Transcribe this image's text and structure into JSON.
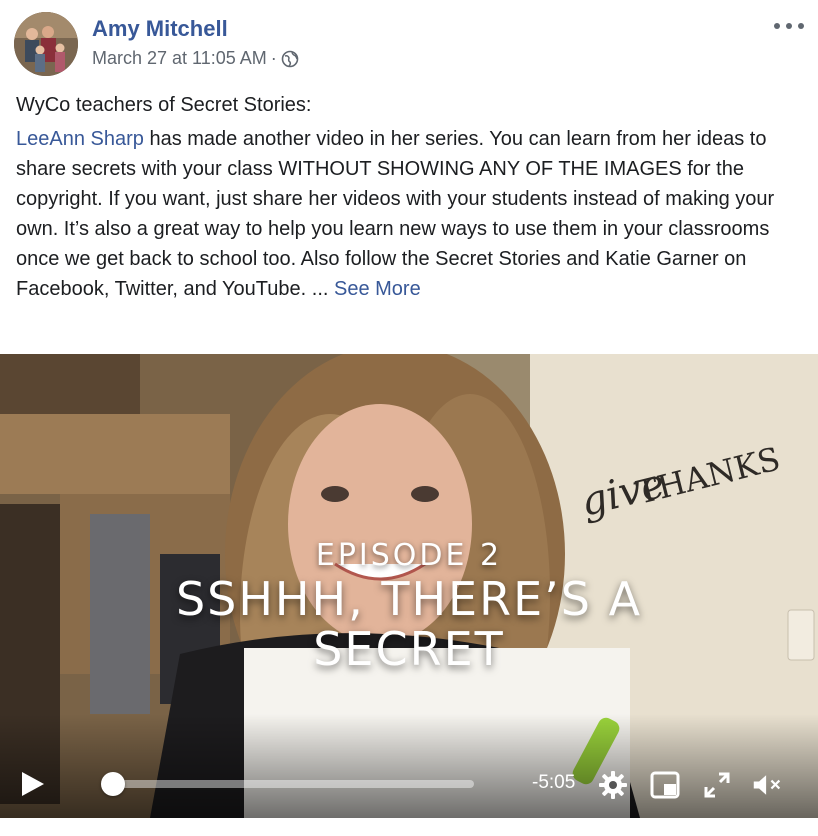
{
  "post": {
    "author": "Amy Mitchell",
    "timestamp": "March 27 at 11:05 AM",
    "separator": "·",
    "privacy_icon": "globe-icon",
    "more_icon": "more-options-icon"
  },
  "text": {
    "intro": "WyCo teachers of Secret Stories:",
    "mention": "LeeAnn Sharp",
    "body": " has made another video in her series. You can learn from her ideas to share secrets with your class WITHOUT SHOWING ANY OF THE IMAGES for the copyright. If you want, just share her videos with your students instead of making your own. It’s also a great way to help you learn new ways to use them in your classrooms once we get back to school too. Also follow the Secret Stories and Katie Garner on Facebook, Twitter, and YouTube. ... ",
    "see_more": "See More"
  },
  "video": {
    "episode": "EPISODE 2",
    "title": "SSHHH, THERE’S A SECRET",
    "wall_sign": "give THANKS",
    "time_remaining": "-5:05",
    "progress_fraction": 0.025,
    "icons": [
      "play-icon",
      "settings-gear-icon",
      "miniplayer-icon",
      "fullscreen-icon",
      "volume-muted-icon"
    ]
  },
  "colors": {
    "link": "#385898",
    "meta": "#606770"
  }
}
